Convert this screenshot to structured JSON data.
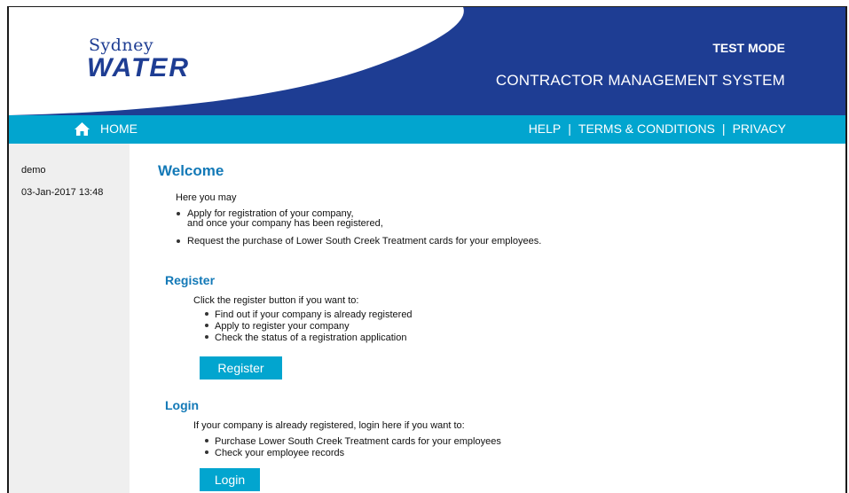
{
  "header": {
    "logo_top": "Sydney",
    "logo_bottom": "WATER",
    "mode": "TEST MODE",
    "system_title": "CONTRACTOR MANAGEMENT SYSTEM"
  },
  "nav": {
    "home": "HOME",
    "help": "HELP",
    "terms": "TERMS & CONDITIONS",
    "privacy": "PRIVACY",
    "separator": "|"
  },
  "sidebar": {
    "user": "demo",
    "datetime": "03-Jan-2017 13:48"
  },
  "welcome": {
    "title": "Welcome",
    "intro": "Here you may",
    "items": [
      [
        "Apply for registration of your company,",
        "and once your company has been registered,"
      ],
      [
        "Request the purchase of Lower South Creek Treatment cards for your employees."
      ]
    ]
  },
  "register": {
    "title": "Register",
    "intro": "Click the register button if you want to:",
    "items": [
      "Find out if your company is already registered",
      "Apply to register your company",
      "Check the status of a registration application"
    ],
    "button": "Register"
  },
  "login": {
    "title": "Login",
    "intro": "If your company is already registered, login here if you want to:",
    "items": [
      "Purchase Lower South Creek Treatment cards for your employees",
      "Check your employee records"
    ],
    "button": "Login"
  },
  "colors": {
    "header_bg": "#1e3d93",
    "nav_bg": "#02a5cf",
    "heading": "#1379b7",
    "button_bg": "#02a5cf"
  }
}
